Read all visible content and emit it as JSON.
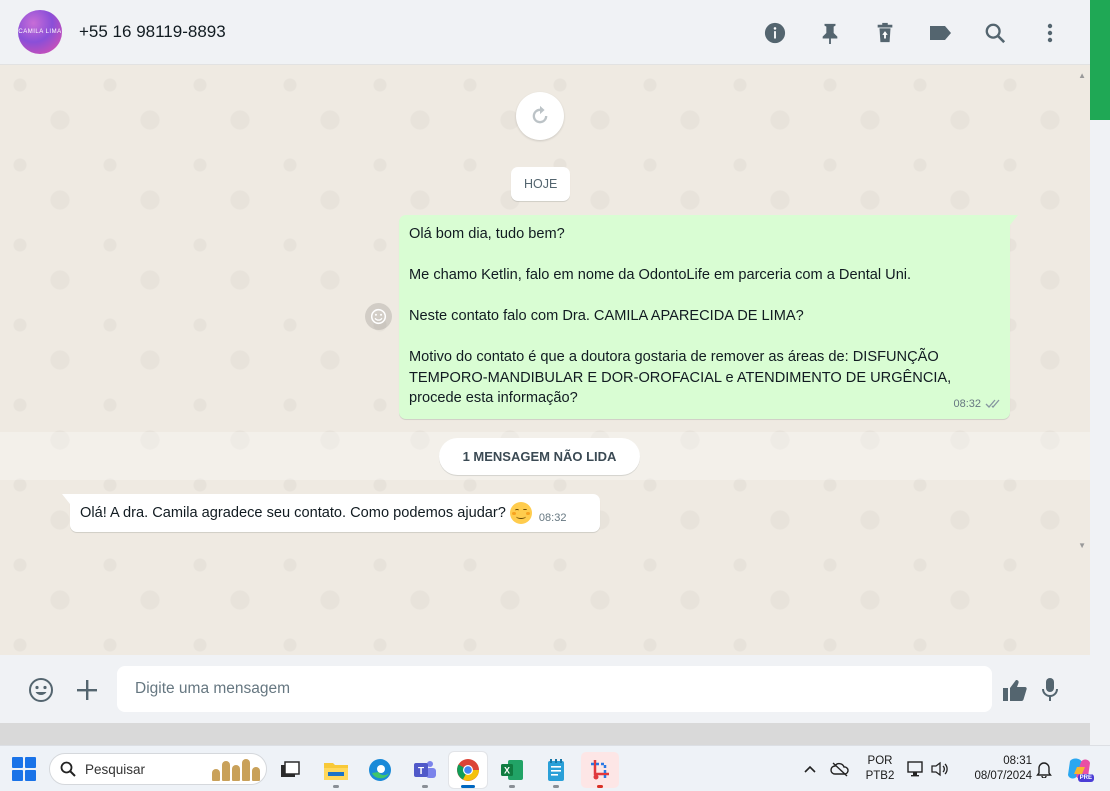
{
  "header": {
    "contact_name": "+55 16 98119-8893",
    "avatar_text": "CAMILA LIMA",
    "icons": [
      "info-icon",
      "pin-icon",
      "delete-icon",
      "label-icon",
      "search-icon",
      "menu-icon"
    ]
  },
  "chat": {
    "date_chip": "HOJE",
    "outgoing": {
      "paragraphs": [
        "Olá bom dia, tudo bem?",
        "Me chamo Ketlin, falo em nome da OdontoLife em parceria com a Dental Uni.",
        "Neste contato falo com Dra. CAMILA APARECIDA DE LIMA?",
        "Motivo do contato é que a doutora gostaria de remover as áreas de: DISFUNÇÃO TEMPORO-MANDIBULAR E DOR-OROFACIAL  e ATENDIMENTO DE URGÊNCIA, procede esta informação?"
      ],
      "time": "08:32",
      "status": "read"
    },
    "unread_chip": "1 MENSAGEM NÃO LIDA",
    "incoming": {
      "text": "Olá! A dra. Camila agradece seu contato. Como podemos ajudar?",
      "emoji": "smiling-blush-emoji",
      "time": "08:32"
    }
  },
  "composer": {
    "placeholder": "Digite uma mensagem"
  },
  "taskbar": {
    "search_placeholder": "Pesquisar",
    "language": "POR",
    "keyboard": "PTB2",
    "time": "08:31",
    "date": "08/07/2024",
    "copilot_badge": "PRE"
  },
  "colors": {
    "outgoing_bubble": "#d9fdd3",
    "accent_green": "#1fa855",
    "header_bg": "#f0f2f5",
    "chat_bg": "#efeae2"
  }
}
